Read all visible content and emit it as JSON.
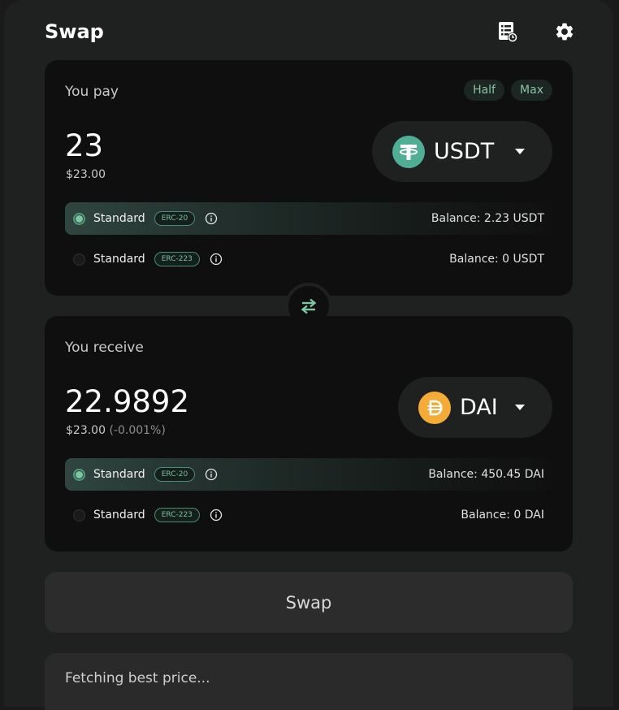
{
  "header": {
    "title": "Swap",
    "history_icon": "history-list-icon",
    "settings_icon": "gear-icon"
  },
  "pay": {
    "label": "You pay",
    "half_label": "Half",
    "max_label": "Max",
    "amount": "23",
    "usd_value": "$23.00",
    "token": {
      "symbol": "USDT",
      "icon": "usdt-logo-icon",
      "color": "#4fae94"
    },
    "standards": [
      {
        "label": "Standard",
        "badge": "ERC-20",
        "balance": "Balance: 2.23 USDT",
        "selected": true
      },
      {
        "label": "Standard",
        "badge": "ERC-223",
        "balance": "Balance: 0 USDT",
        "selected": false
      }
    ]
  },
  "receive": {
    "label": "You receive",
    "amount": "22.9892",
    "usd_value": "$23.00",
    "usd_diff": "(-0.001%)",
    "token": {
      "symbol": "DAI",
      "icon": "dai-logo-icon",
      "color": "#f5ac37"
    },
    "standards": [
      {
        "label": "Standard",
        "badge": "ERC-20",
        "balance": "Balance: 450.45 DAI",
        "selected": true
      },
      {
        "label": "Standard",
        "badge": "ERC-223",
        "balance": "Balance: 0 DAI",
        "selected": false
      }
    ]
  },
  "swap_button_label": "Swap",
  "price_status": "Fetching best price...",
  "colors": {
    "accent": "#7ec6a2",
    "card_bg": "#0f0f0f",
    "page_bg": "#1f2020"
  }
}
